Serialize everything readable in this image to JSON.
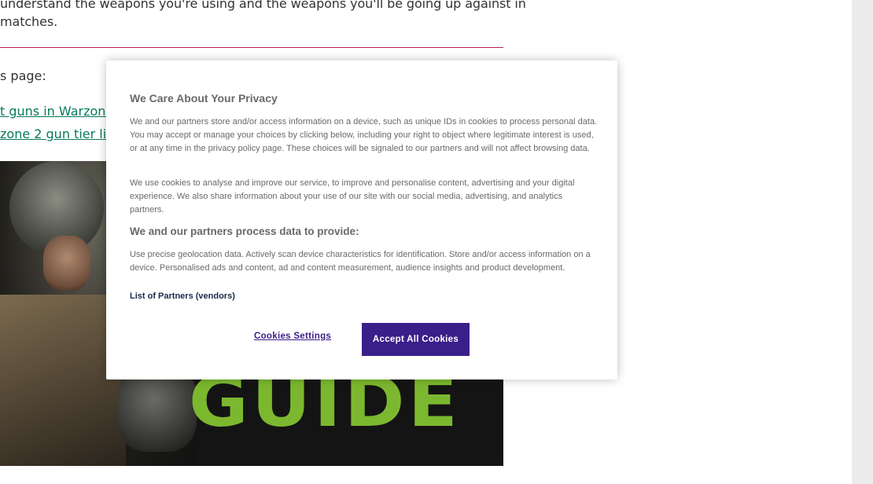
{
  "article": {
    "line1": "understand the weapons you're using and the weapons you'll be going up against in",
    "line2": "matches.",
    "page_label": "s page:",
    "link1": "t guns in Warzone 2",
    "link2": "zone 2 gun tier list",
    "hero_text": "GUIDE",
    "divider_color": "#c2185b",
    "link_color": "#067a5b",
    "hero_text_color": "#7cb82f"
  },
  "cookie_dialog": {
    "title": "We Care About Your Privacy",
    "paragraph1": "We and our partners store and/or access information on a device, such as unique IDs in cookies to process personal data. You may accept or manage your choices by clicking below, including your right to object where legitimate interest is used, or at any time in the privacy policy page. These choices will be signaled to our partners and will not affect browsing data.",
    "paragraph2": "We use cookies to analyse and improve our service, to improve and personalise content, advertising and your digital experience. We also share information about your use of our site with our social media, advertising, and analytics partners.",
    "purposes_heading": "We and our partners process data to provide:",
    "purposes_text": "Use precise geolocation data. Actively scan device characteristics for identification. Store and/or access information on a device. Personalised ads and content, ad and content measurement, audience insights and product development.",
    "partners_link": "List of Partners (vendors)",
    "settings_button": "Cookies Settings",
    "accept_button": "Accept All Cookies",
    "accent_color": "#3a1e8a"
  }
}
